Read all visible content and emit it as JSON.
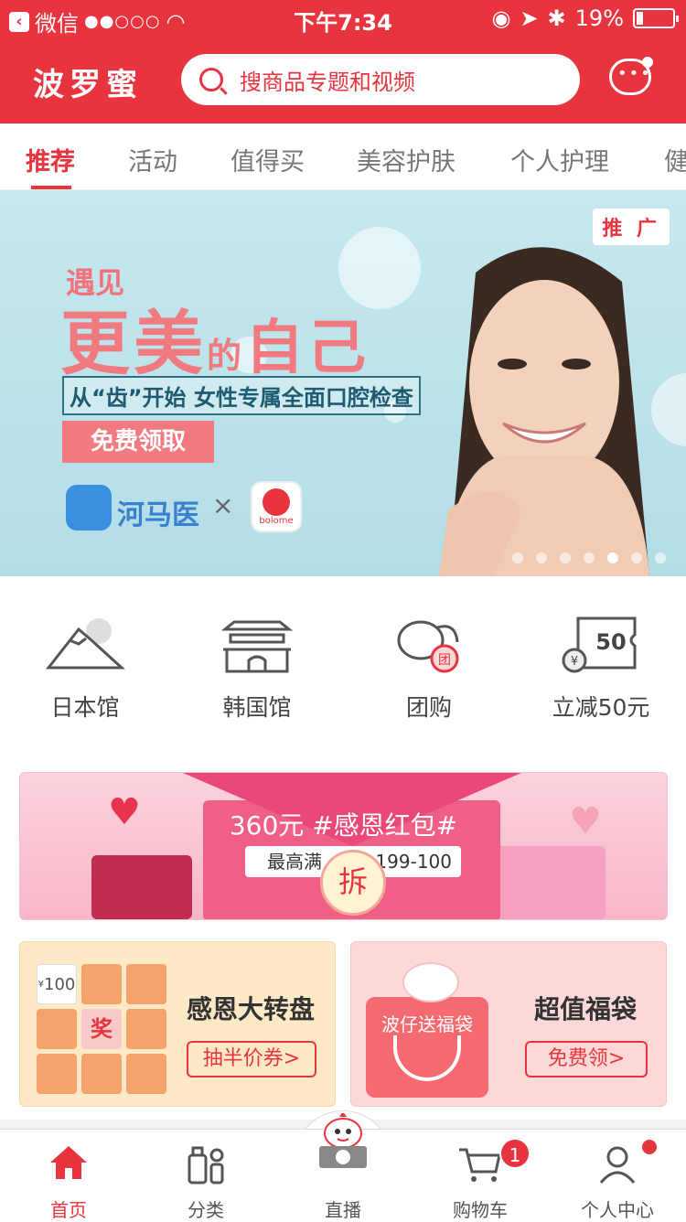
{
  "status_bar": {
    "carrier": "微信",
    "signal": "●●○○○",
    "time": "下午7:34",
    "battery": "19%"
  },
  "header": {
    "logo": "波罗蜜",
    "search_placeholder": "搜商品专题和视频"
  },
  "tabs": [
    "推荐",
    "活动",
    "值得买",
    "美容护肤",
    "个人护理",
    "健"
  ],
  "banner": {
    "tag": "推 广",
    "line1": "遇见",
    "line2a": "更美",
    "line2b": "的",
    "line2c": "自己",
    "line3": "从“齿”开始 女性专属全面口腔检查",
    "button": "免费领取",
    "brand1": "河马医",
    "times": "×",
    "brand2": "bolome",
    "dots": 7,
    "active_dot": 5
  },
  "quick_entries": [
    {
      "label": "日本馆",
      "icon": "mount-fuji-icon"
    },
    {
      "label": "韩国馆",
      "icon": "gate-icon"
    },
    {
      "label": "团购",
      "icon": "group-buy-icon"
    },
    {
      "label": "立减50元",
      "icon": "coupon-50-icon"
    }
  ],
  "red_packet": {
    "title": "360元 #感恩红包#",
    "left_text": "最高满",
    "right_text": "199-100",
    "chai": "拆"
  },
  "cards": [
    {
      "title": "感恩大转盘",
      "button": "抽半价券>",
      "grid_prize": "奖",
      "grid_value": "100",
      "grid_currency": "¥"
    },
    {
      "title": "超值福袋",
      "button": "免费领>",
      "bag_label": "波仔送福袋"
    }
  ],
  "tabbar": [
    {
      "label": "首页",
      "icon": "home-icon",
      "active": true
    },
    {
      "label": "分类",
      "icon": "category-icon",
      "active": false
    },
    {
      "label": "直播",
      "icon": "live-camera-icon",
      "active": false
    },
    {
      "label": "购物车",
      "icon": "cart-icon",
      "active": false
    },
    {
      "label": "个人中心",
      "icon": "user-icon",
      "active": false
    }
  ],
  "cart_badge": "1",
  "colors": {
    "brand": "#e8343f"
  }
}
